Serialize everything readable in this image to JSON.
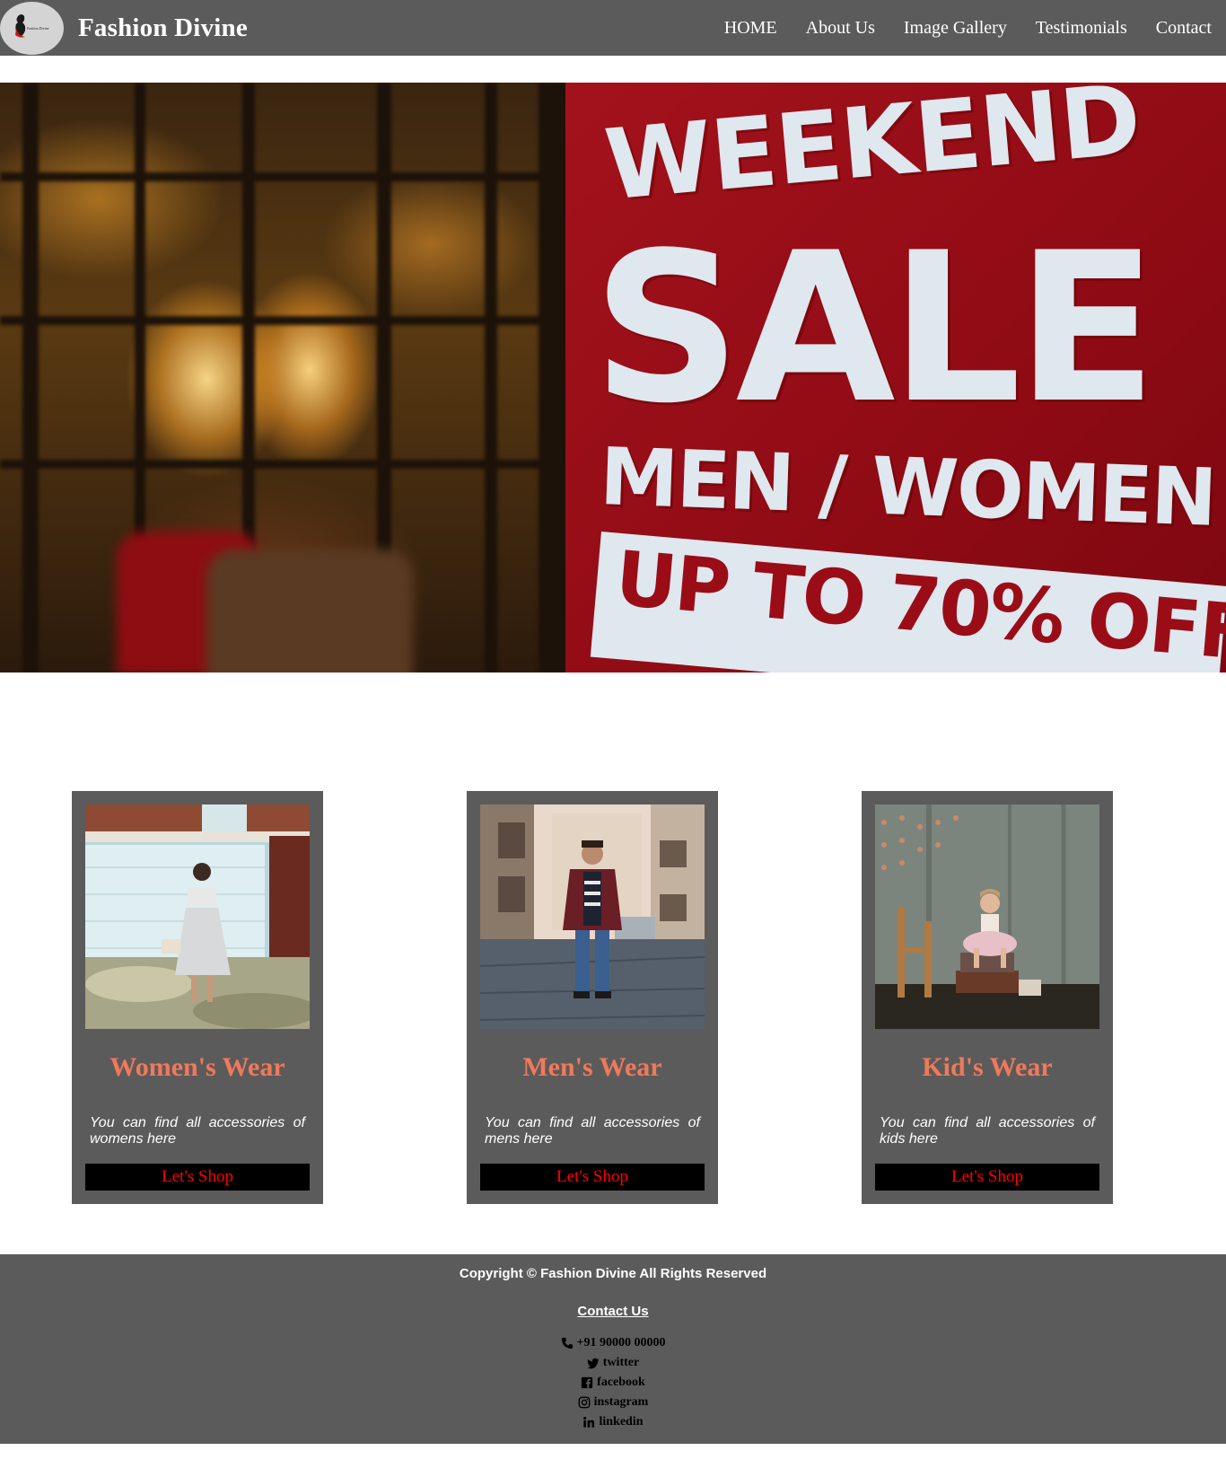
{
  "brand": {
    "name": "Fashion Divine",
    "logo_text": "Fashion Divine"
  },
  "nav": {
    "items": [
      {
        "label": "HOME"
      },
      {
        "label": "About Us"
      },
      {
        "label": "Image Gallery"
      },
      {
        "label": "Testimonials"
      },
      {
        "label": "Contact"
      }
    ]
  },
  "hero": {
    "line1": "WEEKEND",
    "line2": "SALE",
    "line3": "MEN / WOMEN",
    "line4": "UP TO 70% OFF"
  },
  "cards": [
    {
      "title": "Women's Wear",
      "text": "You can find all accessories of womens here",
      "button": "Let's Shop"
    },
    {
      "title": "Men's Wear",
      "text": "You can find all accessories of mens here",
      "button": "Let's Shop"
    },
    {
      "title": "Kid's Wear",
      "text": "You can find all accessories of kids here",
      "button": "Let's Shop"
    }
  ],
  "footer": {
    "copyright": "Copyright © Fashion Divine All Rights Reserved",
    "contact_title": "Contact Us",
    "contacts": [
      {
        "icon": "phone-icon",
        "label": "+91 90000 00000"
      },
      {
        "icon": "twitter-icon",
        "label": "twitter"
      },
      {
        "icon": "facebook-icon",
        "label": "facebook"
      },
      {
        "icon": "instagram-icon",
        "label": "instagram"
      },
      {
        "icon": "linkedin-icon",
        "label": "linkedin"
      }
    ]
  },
  "colors": {
    "navbar_bg": "#5b5b5b",
    "card_bg": "#5b5b5b",
    "card_title": "#f0795a",
    "button_bg": "#000000",
    "button_text": "#ff0000",
    "hero_sign": "#a3121c"
  }
}
